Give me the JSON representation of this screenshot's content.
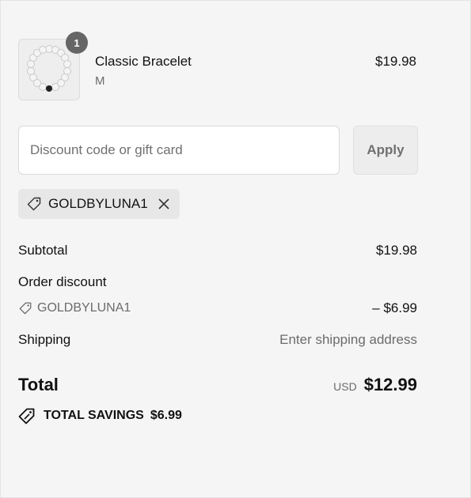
{
  "product": {
    "quantity": "1",
    "name": "Classic Bracelet",
    "variant": "M",
    "price": "$19.98",
    "image_icon": "bracelet-image"
  },
  "discount": {
    "placeholder": "Discount code or gift card",
    "value": "",
    "apply_label": "Apply",
    "applied_code": "GOLDBYLUNA1"
  },
  "summary": {
    "subtotal_label": "Subtotal",
    "subtotal_value": "$19.98",
    "order_discount_label": "Order discount",
    "discount_code": "GOLDBYLUNA1",
    "discount_value": "– $6.99",
    "shipping_label": "Shipping",
    "shipping_value": "Enter shipping address",
    "total_label": "Total",
    "currency": "USD",
    "total_value": "$12.99",
    "savings_label": "TOTAL SAVINGS",
    "savings_value": "$6.99"
  },
  "icons": {
    "tag": "tag-icon",
    "close": "close-icon",
    "savings": "savings-tag-icon"
  }
}
